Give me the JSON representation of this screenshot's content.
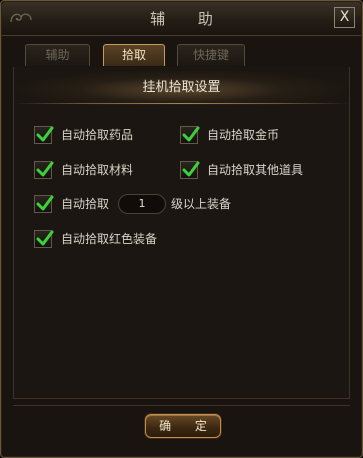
{
  "dialog": {
    "title": "辅 助",
    "close_label": "X"
  },
  "tabs": [
    {
      "label": "辅助",
      "active": false
    },
    {
      "label": "拾取",
      "active": true
    },
    {
      "label": "快捷键",
      "active": false
    }
  ],
  "section": {
    "title": "挂机拾取设置"
  },
  "options": {
    "pick_medicine": {
      "label": "自动拾取药品",
      "checked": true
    },
    "pick_gold": {
      "label": "自动拾取金币",
      "checked": true
    },
    "pick_materials": {
      "label": "自动拾取材料",
      "checked": true
    },
    "pick_other_items": {
      "label": "自动拾取其他道具",
      "checked": true
    },
    "pick_level_equipment": {
      "label": "自动拾取",
      "checked": true,
      "level_value": "1",
      "suffix": "级以上装备"
    },
    "pick_red_equipment": {
      "label": "自动拾取红色装备",
      "checked": true
    }
  },
  "confirm_button": {
    "label": "确 定"
  },
  "colors": {
    "checkmark": "#3cd23c",
    "accent_gold": "#c79b56",
    "panel_bg": "#1b1611"
  },
  "icons": {
    "checkmark": "checkmark-icon",
    "close": "close-icon",
    "ornament": "corner-ornament-icon"
  }
}
